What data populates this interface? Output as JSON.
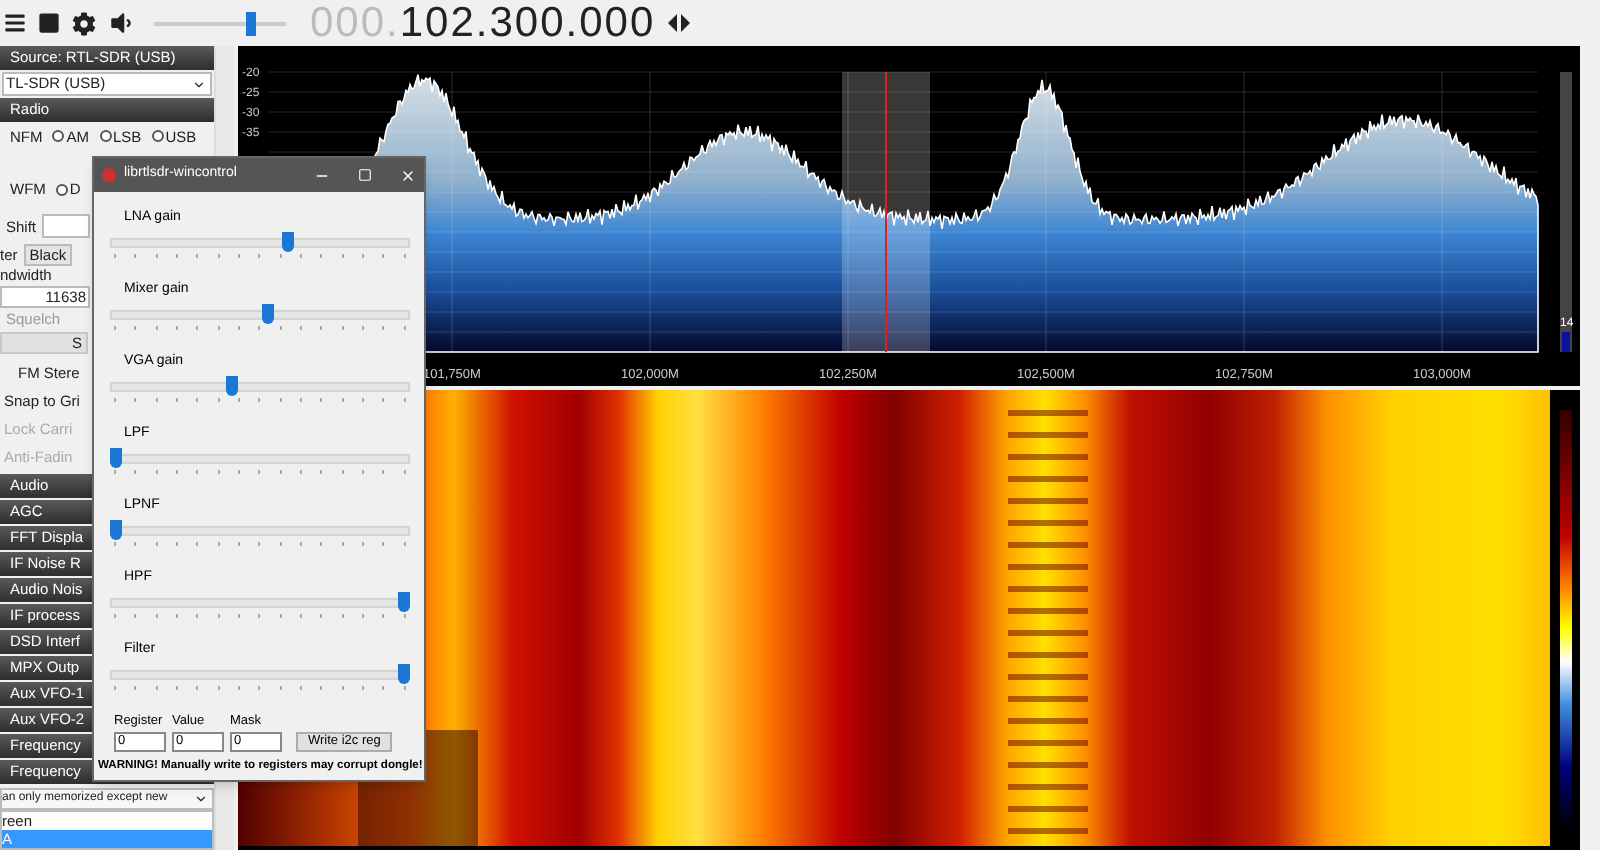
{
  "toolbar": {
    "volume": {
      "level": 0.75
    },
    "frequency_prefix": "000.",
    "frequency": "102.300.000"
  },
  "left_panel": {
    "source_header": "Source: RTL-SDR (USB)",
    "device_select": "TL-SDR (USB)",
    "radio_header": "Radio",
    "mode_rows": [
      [
        {
          "label": "NFM",
          "kind": "label",
          "selected": false
        },
        {
          "label": "AM",
          "kind": "radio",
          "selected": false
        },
        {
          "label": "LSB",
          "kind": "radio",
          "selected": false
        },
        {
          "label": "USB",
          "kind": "radio",
          "selected": false
        }
      ],
      [
        {
          "label": "WFM",
          "kind": "label",
          "selected": false
        },
        {
          "label": "D",
          "kind": "radio",
          "selected": false
        }
      ]
    ],
    "shift_label": "Shift",
    "filter_label": "ter",
    "filter_select": "Black",
    "bandwidth_label": "ndwidth",
    "bandwidth_value": "11638",
    "squelch_label": "Squelch",
    "squelch_button": "S",
    "options": [
      {
        "label": "FM Stere",
        "disabled": false
      },
      {
        "label": "Snap to Gri",
        "disabled": false
      },
      {
        "label": "Lock Carri",
        "disabled": true
      },
      {
        "label": "Anti-Fadin",
        "disabled": true
      }
    ],
    "sections": [
      "Audio",
      "AGC",
      "FFT Displa",
      "IF Noise R",
      "Audio Nois",
      "IF process",
      "DSD Interf",
      "MPX Outp",
      "Aux VFO-1",
      "Aux VFO-2",
      "Frequency",
      "Frequency"
    ],
    "memory_select": "an only memorized except new",
    "memory_list": [
      {
        "label": "reen",
        "selected": false
      },
      {
        "label": "A",
        "selected": true
      }
    ]
  },
  "spectrum": {
    "y_ticks": [
      "-20",
      "-25",
      "-30",
      "-35"
    ],
    "x_ticks": [
      "101,750M",
      "102,000M",
      "102,250M",
      "102,500M",
      "102,750M",
      "103,000M"
    ],
    "level_reading": "14"
  },
  "dialog": {
    "title": "librtlsdr-wincontrol",
    "sliders": [
      {
        "label": "LNA gain",
        "level": 0.6
      },
      {
        "label": "Mixer gain",
        "level": 0.53
      },
      {
        "label": "VGA gain",
        "level": 0.4
      },
      {
        "label": "LPF",
        "level": 0
      },
      {
        "label": "LPNF",
        "level": 0
      },
      {
        "label": "HPF",
        "level": 1
      },
      {
        "label": "Filter",
        "level": 1
      }
    ],
    "registers": [
      {
        "label": "Register",
        "value": "0"
      },
      {
        "label": "Value",
        "value": "0"
      },
      {
        "label": "Mask",
        "value": "0"
      }
    ],
    "write_button": "Write i2c reg",
    "warning": "WARNING! Manually write to registers may corrupt dongle!"
  }
}
